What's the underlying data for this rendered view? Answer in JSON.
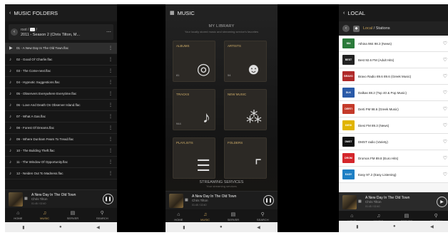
{
  "colors": {
    "accent": "#c8a25a",
    "dark_bg": "#161616",
    "light_bg": "#f6f6f6"
  },
  "nav": [
    {
      "label": "HOME",
      "icon": "home-icon"
    },
    {
      "label": "MUSIC",
      "icon": "music-icon"
    },
    {
      "label": "SERVER",
      "icon": "server-icon"
    },
    {
      "label": "SEARCH",
      "icon": "search-icon"
    }
  ],
  "now_playing": {
    "title": "A New Day In The Old Town",
    "artist": "Chris Tilton",
    "time": "01:45 / 02:40"
  },
  "folders": {
    "title": "MUSIC FOLDERS",
    "crumb_root": "root",
    "crumb_badge": "...",
    "folder_name": "2011 - Season 2 (Chris Tilton, M...",
    "tracks": [
      "01 - A New Day In The Old Town.flac",
      "02 - Good Ol' Charlie.flac",
      "03 - The Come-next.flac",
      "04 - Hypnotic Suggestions.flac",
      "05 - Observers Everywhere Everytime.flac",
      "06 - Love And Death On Observer Island.flac",
      "07 - What A Gas.flac",
      "08 - Forest Of Dreams.flac",
      "09 - Where Dunham Fears To Tread.flac",
      "10 - The Building Theft.flac",
      "11 - The Window Of Opportunity.flac",
      "12 - Neiden Out To Madness.flac"
    ]
  },
  "music": {
    "title": "MUSIC",
    "library_heading": "MY LIBRARY",
    "library_sub": "Your locally stored music and streaming service's favorites",
    "tiles": [
      {
        "label": "ALBUMS",
        "count": "81"
      },
      {
        "label": "ARTISTS",
        "count": "54"
      },
      {
        "label": "TRACKS",
        "count": "944"
      },
      {
        "label": "NEW MUSIC",
        "count": ""
      },
      {
        "label": "PLAYLISTS",
        "count": ""
      },
      {
        "label": "FOLDERS",
        "count": ""
      }
    ],
    "streaming_heading": "STREAMING SERVICES",
    "streaming_sub": "Your streaming services"
  },
  "local": {
    "title": "LOCAL",
    "crumb_local": "Local",
    "crumb_sep": " / ",
    "crumb_stations": "Stations",
    "stations": [
      {
        "name": "Athina 984 98.3 (News)",
        "logo": "984",
        "color": "#2a7a3a"
      },
      {
        "name": "Best 92.6 FM (Adult Hits)",
        "logo": "BEST",
        "color": "#222222"
      },
      {
        "name": "Bravo Radio 89.6 89.6 (Greek Music)",
        "logo": "BRAVO",
        "color": "#b02a2a"
      },
      {
        "name": "Dalkas 88.2 (Top 40 & Pop Music)",
        "logo": "DLK",
        "color": "#2a5aa8"
      },
      {
        "name": "Derti FM 98.6 (Greek Music)",
        "logo": "DERTI",
        "color": "#c43a2a"
      },
      {
        "name": "Diesi FM 89.3 (News)",
        "logo": "DIESI",
        "color": "#e0b400"
      },
      {
        "name": "DMST radio (Variety)",
        "logo": "DMST",
        "color": "#111111"
      },
      {
        "name": "Dromos FM 89.8 (Euro Hits)",
        "logo": "DROM",
        "color": "#d4262b"
      },
      {
        "name": "Easy 97.2 (Easy Listening)",
        "logo": "EASY",
        "color": "#1e7fc4"
      }
    ]
  }
}
